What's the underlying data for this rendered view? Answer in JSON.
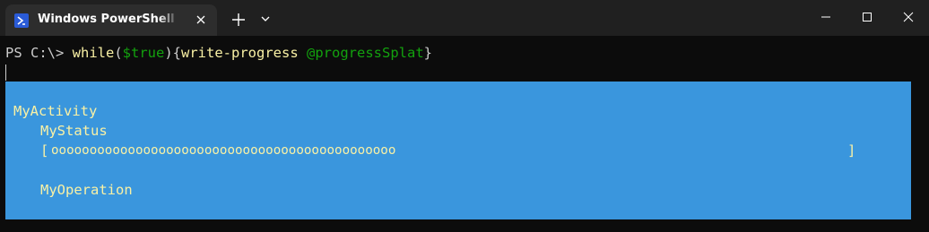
{
  "tab": {
    "title": "Windows PowerShell NoProfile",
    "icon": "powershell-icon"
  },
  "titlebar": {
    "new_tab_icon": "plus-icon",
    "dropdown_icon": "chevron-down-icon",
    "minimize_icon": "minimize-icon",
    "maximize_icon": "maximize-icon",
    "close_icon": "close-icon"
  },
  "terminal": {
    "prompt": "PS C:\\> ",
    "command": {
      "keyword": "while",
      "open_paren": "(",
      "variable": "$true",
      "close_brace_group": "){",
      "cmdlet": "write-progress",
      "space": " ",
      "argument": "@progressSplat",
      "end_brace": "}"
    }
  },
  "progress": {
    "activity": "MyActivity",
    "status": "MyStatus",
    "bar_open": "[",
    "bar_fill": "ooooooooooooooooooooooooooooooooooooooooooooo",
    "bar_close": "]",
    "operation": "MyOperation",
    "percent_complete": 50
  },
  "colors": {
    "progress_background": "#3a96dd",
    "progress_text": "#f9f1a5",
    "terminal_background": "#0c0c0c",
    "keyword": "#f9f1a5",
    "variable": "#13a10e"
  }
}
